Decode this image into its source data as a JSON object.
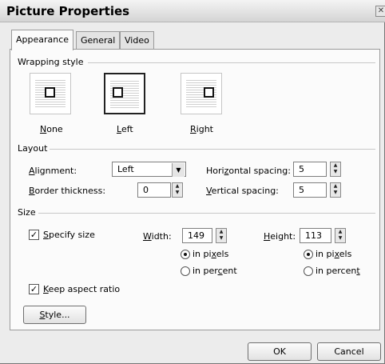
{
  "window": {
    "title": "Picture Properties",
    "close_glyph": "✕"
  },
  "tabs": [
    {
      "label": "Appearance",
      "active": true
    },
    {
      "label": "General",
      "active": false
    },
    {
      "label": "Video",
      "active": false
    }
  ],
  "wrapping": {
    "label": "Wrapping style",
    "options": [
      {
        "label": "None",
        "mnemonic": "N",
        "rest": "one",
        "selected": false
      },
      {
        "label": "Left",
        "mnemonic": "L",
        "rest": "eft",
        "selected": true
      },
      {
        "label": "Right",
        "mnemonic": "R",
        "rest": "ight",
        "selected": false
      }
    ]
  },
  "layout": {
    "label": "Layout",
    "alignment": {
      "label_m": "A",
      "label_r": "lignment:",
      "value": "Left"
    },
    "border": {
      "label_m": "B",
      "label_r": "order thickness:",
      "value": "0"
    },
    "hspacing": {
      "label_a": "Hori",
      "label_m": "z",
      "label_r": "ontal spacing:",
      "value": "5"
    },
    "vspacing": {
      "label_m": "V",
      "label_r": "ertical spacing:",
      "value": "5"
    }
  },
  "size": {
    "label": "Size",
    "specify": {
      "label_m": "S",
      "label_r": "pecify size",
      "checked": true
    },
    "width": {
      "label_m": "W",
      "label_r": "idth:",
      "value": "149",
      "px_a": "in pi",
      "px_m": "x",
      "px_r": "els",
      "pct_a": "in per",
      "pct_m": "c",
      "pct_r": "ent",
      "unit": "pixels"
    },
    "height": {
      "label_m": "H",
      "label_r": "eight:",
      "value": "113",
      "px_a": "in pi",
      "px_m": "x",
      "px_r": "els",
      "pct_a": "in percen",
      "pct_m": "t",
      "pct_r": "",
      "unit": "pixels"
    },
    "keep_aspect": {
      "label_m": "K",
      "label_r": "eep aspect ratio",
      "checked": true
    }
  },
  "buttons": {
    "style": {
      "m": "S",
      "r": "tyle..."
    },
    "ok": "OK",
    "cancel": "Cancel"
  }
}
